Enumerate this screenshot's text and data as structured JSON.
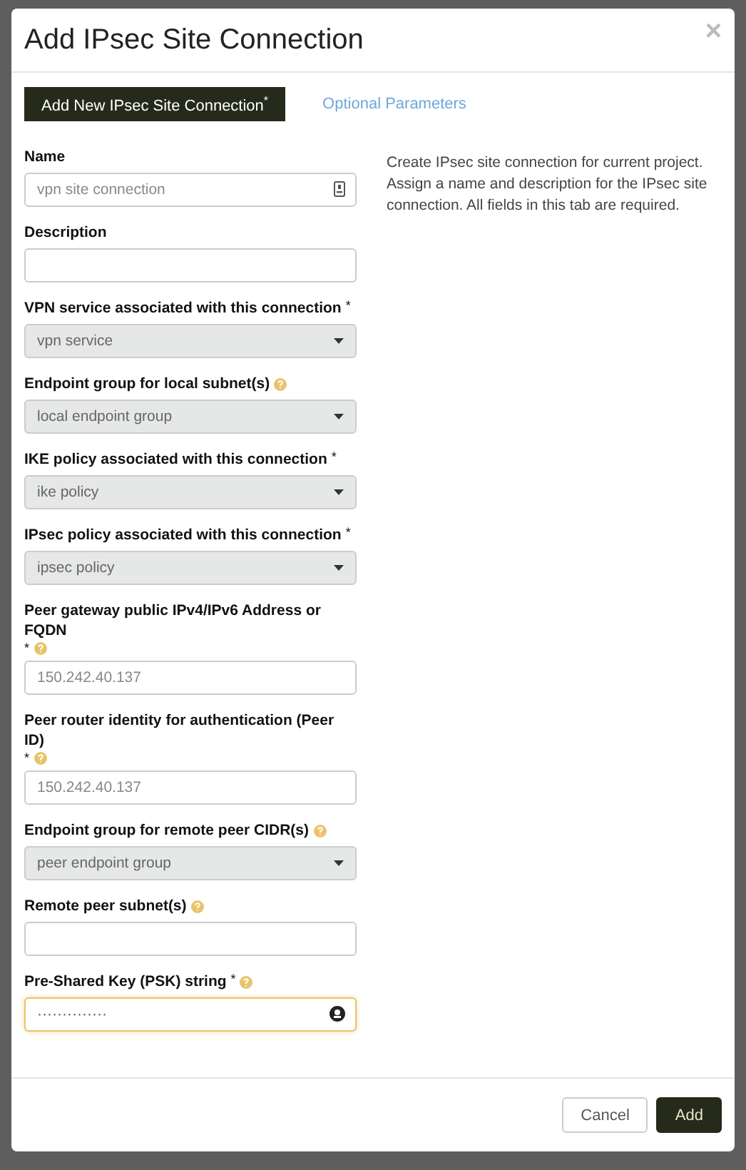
{
  "dialog": {
    "title": "Add IPsec Site Connection",
    "close": "×"
  },
  "tabs": [
    {
      "label": "Add New IPsec Site Connection",
      "required_mark": "*",
      "selected": true
    },
    {
      "label": "Optional Parameters",
      "selected": false
    }
  ],
  "fields": [
    {
      "kind": "text",
      "label": "Name",
      "help": false,
      "placeholder": "vpn site connection",
      "icon": true
    },
    {
      "kind": "text",
      "label": "Description",
      "help": false
    },
    {
      "kind": "select",
      "label": "VPN service associated with this connection",
      "required_mark": "*",
      "help": false,
      "value": "vpn service"
    },
    {
      "kind": "select",
      "label": "Endpoint group for local subnet(s)",
      "help": true,
      "value": "local endpoint group"
    },
    {
      "kind": "select",
      "label": "IKE policy associated with this connection",
      "required_mark": "*",
      "help": false,
      "value": "ike policy"
    },
    {
      "kind": "select",
      "label": "IPsec policy associated with this connection",
      "required_mark": "*",
      "help": false,
      "value": "ipsec policy"
    },
    {
      "kind": "text",
      "label": "Peer gateway public IPv4/IPv6 Address or FQDN",
      "required_mark": "*",
      "help": true,
      "placeholder": "150.242.40.137"
    },
    {
      "kind": "text",
      "label": "Peer router identity for authentication (Peer ID)",
      "required_mark": "*",
      "help": true,
      "placeholder": "150.242.40.137"
    },
    {
      "kind": "select",
      "label": "Endpoint group for remote peer CIDR(s)",
      "help": true,
      "value": "peer endpoint group"
    },
    {
      "kind": "text",
      "label": "Remote peer subnet(s)",
      "help": true
    },
    {
      "kind": "password",
      "label": "Pre-Shared Key (PSK) string",
      "required_mark": "*",
      "help": true,
      "value": "··············",
      "focused": true
    }
  ],
  "help_text": "Create IPsec site connection for current project. Assign a name and description for the IPsec site connection. All fields in this tab are required.",
  "buttons": [
    {
      "label": "Cancel",
      "kind": "secondary"
    },
    {
      "label": "Add",
      "kind": "primary"
    }
  ]
}
